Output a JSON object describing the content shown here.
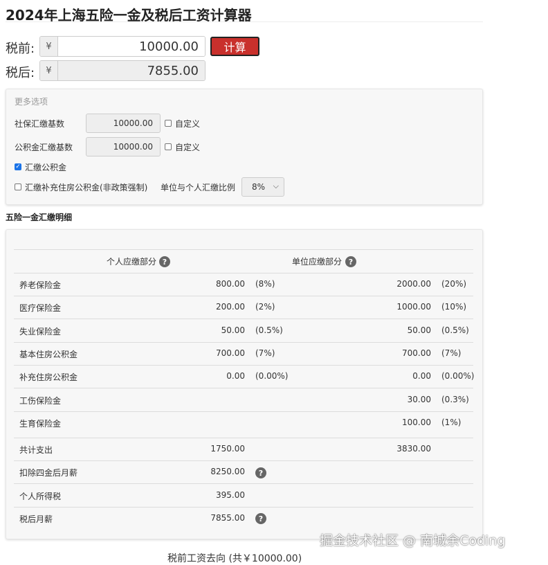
{
  "page": {
    "title": "2024年上海五险一金及税后工资计算器"
  },
  "pre_tax": {
    "label": "税前:",
    "currency": "¥",
    "value": "10000.00"
  },
  "post_tax": {
    "label": "税后:",
    "currency": "¥",
    "value": "7855.00"
  },
  "calc_button": "计算",
  "options": {
    "title": "更多选项",
    "social_base_label": "社保汇缴基数",
    "social_base_value": "10000.00",
    "fund_base_label": "公积金汇缴基数",
    "fund_base_value": "10000.00",
    "custom_label": "自定义",
    "pay_fund_label": "汇缴公积金",
    "pay_fund_checked": true,
    "supp_fund_label": "汇缴补充住房公积金(非政策强制)",
    "supp_fund_checked": false,
    "ratio_label": "单位与个人汇缴比例",
    "ratio_value": "8%"
  },
  "details": {
    "title": "五险一金汇缴明细",
    "personal_header": "个人应缴部分",
    "company_header": "单位应缴部分",
    "help_glyph": "?",
    "rows": [
      {
        "name": "养老保险金",
        "p_amt": "800.00",
        "p_pct": "(8%)",
        "c_amt": "2000.00",
        "c_pct": "(20%)"
      },
      {
        "name": "医疗保险金",
        "p_amt": "200.00",
        "p_pct": "(2%)",
        "c_amt": "1000.00",
        "c_pct": "(10%)"
      },
      {
        "name": "失业保险金",
        "p_amt": "50.00",
        "p_pct": "(0.5%)",
        "c_amt": "50.00",
        "c_pct": "(0.5%)"
      },
      {
        "name": "基本住房公积金",
        "p_amt": "700.00",
        "p_pct": "(7%)",
        "c_amt": "700.00",
        "c_pct": "(7%)"
      },
      {
        "name": "补充住房公积金",
        "p_amt": "0.00",
        "p_pct": "(0.00%)",
        "c_amt": "0.00",
        "c_pct": "(0.00%)"
      },
      {
        "name": "工伤保险金",
        "p_amt": "",
        "p_pct": "",
        "c_amt": "30.00",
        "c_pct": "(0.3%)"
      },
      {
        "name": "生育保险金",
        "p_amt": "",
        "p_pct": "",
        "c_amt": "100.00",
        "c_pct": "(1%)"
      }
    ],
    "total": {
      "label": "共计支出",
      "personal": "1750.00",
      "company": "3830.00"
    },
    "after_deduct": {
      "label": "扣除四金后月薪",
      "value": "8250.00"
    },
    "income_tax": {
      "label": "个人所得税",
      "value": "395.00"
    },
    "net_salary": {
      "label": "税后月薪",
      "value": "7855.00"
    }
  },
  "footer": {
    "flow_title": "税前工资去向 (共￥10000.00)"
  },
  "watermark": "掘金技术社区 @ 南城余Coding",
  "colors": {
    "button_red": "#c9302c",
    "checkbox_blue": "#1a73e8"
  }
}
